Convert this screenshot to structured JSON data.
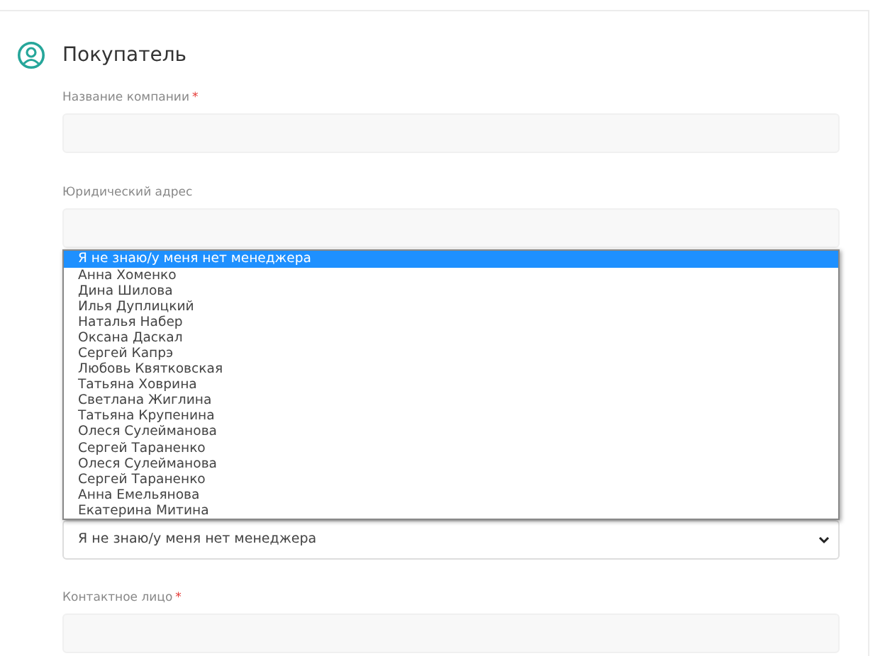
{
  "section": {
    "title": "Покупатель"
  },
  "fields": [
    {
      "label": "Название компании",
      "required_mark": "*"
    },
    {
      "label": "Юридический адрес"
    }
  ],
  "manager_select": {
    "value": "Я не знаю/у меня нет менеджера",
    "options": [
      {
        "label": "Я не знаю/у меня нет менеджера",
        "selected": true
      },
      {
        "label": "Анна Хоменко",
        "selected": false
      },
      {
        "label": "Дина Шилова",
        "selected": false
      },
      {
        "label": "Илья Дуплицкий",
        "selected": false
      },
      {
        "label": "Наталья Набер",
        "selected": false
      },
      {
        "label": "Оксана Даскал",
        "selected": false
      },
      {
        "label": "Сергей Капрэ",
        "selected": false
      },
      {
        "label": "Любовь Квятковская",
        "selected": false
      },
      {
        "label": "Татьяна Ховрина",
        "selected": false
      },
      {
        "label": "Светлана Жиглина",
        "selected": false
      },
      {
        "label": "Татьяна Крупенина",
        "selected": false
      },
      {
        "label": "Олеся Сулейманова",
        "selected": false
      },
      {
        "label": "Сергей Тараненко",
        "selected": false
      },
      {
        "label": "Олеся Сулейманова",
        "selected": false
      },
      {
        "label": "Сергей Тараненко",
        "selected": false
      },
      {
        "label": "Анна Емельянова",
        "selected": false
      },
      {
        "label": "Екатерина Митина",
        "selected": false
      }
    ]
  },
  "contact_field": {
    "label": "Контактное лицо",
    "required_mark": "*"
  }
}
